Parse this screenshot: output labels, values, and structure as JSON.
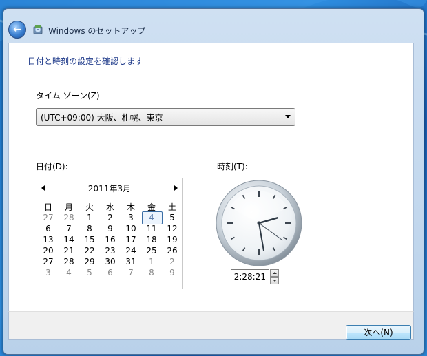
{
  "window": {
    "title": "Windows のセットアップ",
    "icon": "setup-disc-icon"
  },
  "page": {
    "heading": "日付と時刻の設定を確認します"
  },
  "timezone": {
    "label": "タイム ゾーン(Z)",
    "value": "(UTC+09:00) 大阪、札幌、東京"
  },
  "date": {
    "label": "日付(D):",
    "month_title": "2011年3月",
    "weekdays": [
      "日",
      "月",
      "火",
      "水",
      "木",
      "金",
      "土"
    ],
    "days": [
      {
        "d": "27",
        "other": true
      },
      {
        "d": "28",
        "other": true
      },
      {
        "d": "1"
      },
      {
        "d": "2"
      },
      {
        "d": "3"
      },
      {
        "d": "4",
        "selected": true
      },
      {
        "d": "5"
      },
      {
        "d": "6"
      },
      {
        "d": "7"
      },
      {
        "d": "8"
      },
      {
        "d": "9"
      },
      {
        "d": "10"
      },
      {
        "d": "11"
      },
      {
        "d": "12"
      },
      {
        "d": "13"
      },
      {
        "d": "14"
      },
      {
        "d": "15"
      },
      {
        "d": "16"
      },
      {
        "d": "17"
      },
      {
        "d": "18"
      },
      {
        "d": "19"
      },
      {
        "d": "20"
      },
      {
        "d": "21"
      },
      {
        "d": "22"
      },
      {
        "d": "23"
      },
      {
        "d": "24"
      },
      {
        "d": "25"
      },
      {
        "d": "26"
      },
      {
        "d": "27"
      },
      {
        "d": "28"
      },
      {
        "d": "29"
      },
      {
        "d": "30"
      },
      {
        "d": "31"
      },
      {
        "d": "1",
        "other": true
      },
      {
        "d": "2",
        "other": true
      },
      {
        "d": "3",
        "other": true
      },
      {
        "d": "4",
        "other": true
      },
      {
        "d": "5",
        "other": true
      },
      {
        "d": "6",
        "other": true
      },
      {
        "d": "7",
        "other": true
      },
      {
        "d": "8",
        "other": true
      },
      {
        "d": "9",
        "other": true
      }
    ]
  },
  "time": {
    "label": "時刻(T):",
    "value": "2:28:21",
    "hour": 2,
    "minute": 28,
    "second": 21
  },
  "footer": {
    "next_label": "次へ(N)"
  },
  "colors": {
    "heading": "#1e3a8a",
    "selection_border": "#3b6ea5",
    "desktop": "#1b73c8"
  }
}
